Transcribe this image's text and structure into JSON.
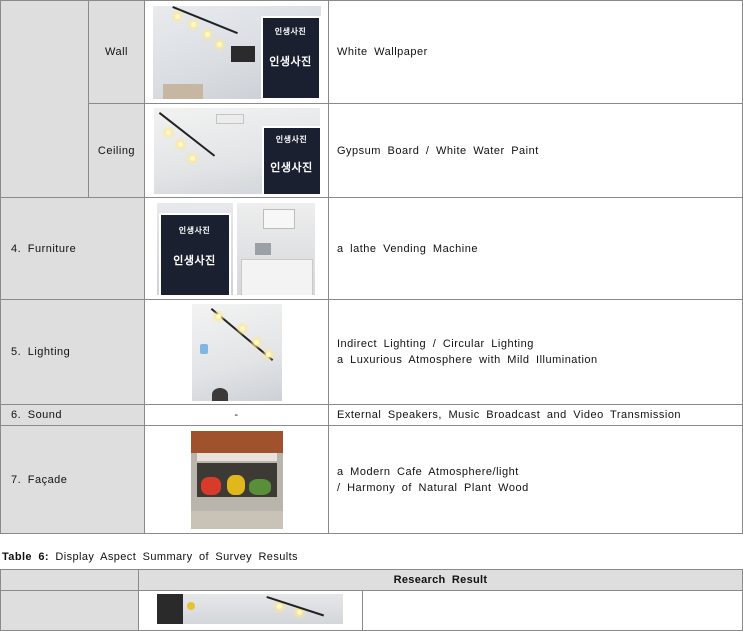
{
  "rows": {
    "wall": {
      "label": "Wall",
      "description": "White Wallpaper"
    },
    "ceiling": {
      "label": "Ceiling",
      "description": "Gypsum Board / White Water Paint"
    },
    "furniture": {
      "label": "4. Furniture",
      "description": "a lathe Vending Machine"
    },
    "lighting": {
      "label": "5. Lighting",
      "description_line1": "Indirect Lighting / Circular Lighting",
      "description_line2": "a Luxurious Atmosphere with Mild Illumination"
    },
    "sound": {
      "label": "6. Sound",
      "image_placeholder": "-",
      "description": "External Speakers, Music Broadcast and Video Transmission"
    },
    "facade": {
      "label": "7. Façade",
      "description_line1": "a Modern Cafe Atmosphere/light",
      "description_line2": "/ Harmony of Natural Plant Wood"
    }
  },
  "photo_sign_text": {
    "top": "인생사진",
    "main": "인생사진"
  },
  "table6": {
    "caption_label": "Table 6:",
    "caption_text": "Display Aspect Summary of Survey Results",
    "header": "Research Result"
  },
  "colors": {
    "label_cell_bg": "#dedede",
    "border": "#8a8a8a"
  }
}
